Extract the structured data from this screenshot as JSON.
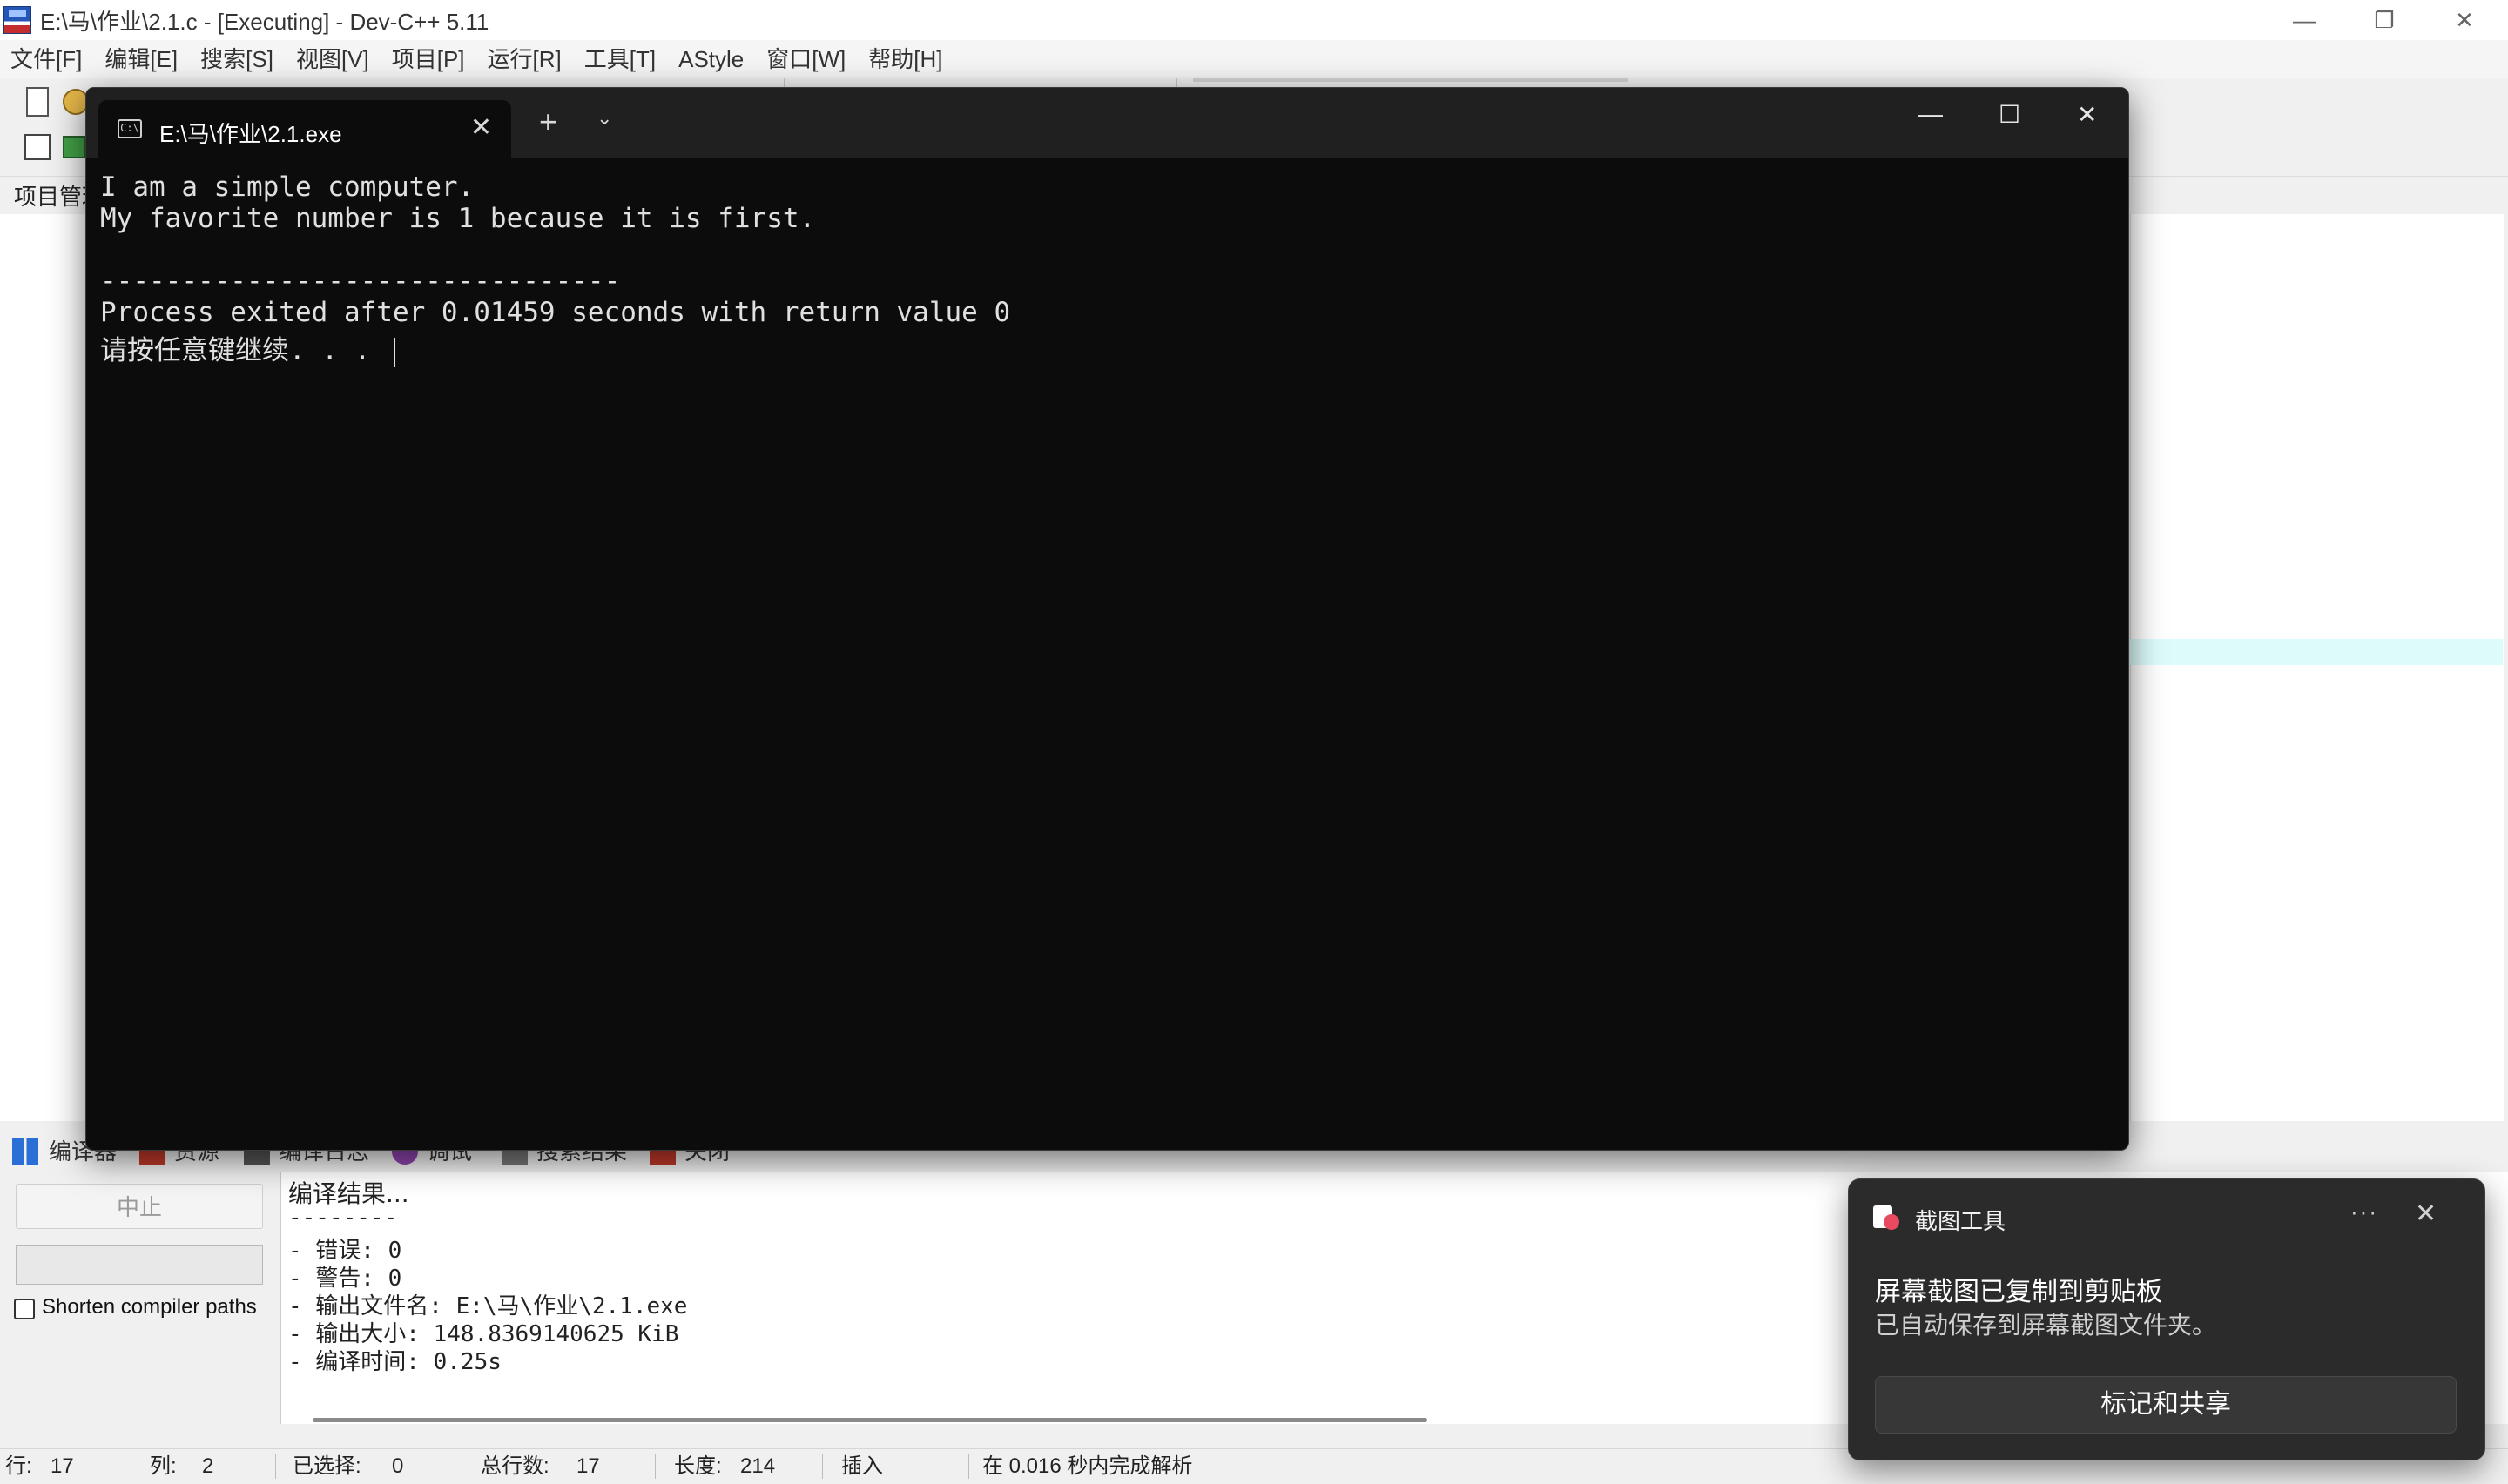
{
  "ide": {
    "title": "E:\\马\\作业\\2.1.c - [Executing] - Dev-C++ 5.11",
    "window_controls": {
      "minimize": "—",
      "restore": "❐",
      "close": "✕"
    },
    "menu": [
      "文件[F]",
      "编辑[E]",
      "搜索[S]",
      "视图[V]",
      "项目[P]",
      "运行[R]",
      "工具[T]",
      "AStyle",
      "窗口[W]",
      "帮助[H]"
    ],
    "project_label": "项目管理",
    "bottom_tabs": [
      "编译器",
      "资源",
      "编译日志",
      "调试",
      "搜索结果",
      "关闭"
    ],
    "compiler": {
      "abort_label": "中止",
      "shorten_label": "Shorten compiler paths",
      "log": [
        "编译结果...",
        "--------",
        "- 错误: 0",
        "- 警告: 0",
        "- 输出文件名: E:\\马\\作业\\2.1.exe",
        "- 输出大小: 148.8369140625 KiB",
        "- 编译时间: 0.25s"
      ]
    },
    "status": {
      "line_label": "行:",
      "line_value": "17",
      "col_label": "列:",
      "col_value": "2",
      "sel_label": "已选择:",
      "sel_value": "0",
      "total_label": "总行数:",
      "total_value": "17",
      "len_label": "长度:",
      "len_value": "214",
      "mode": "插入",
      "parse_msg": "在 0.016 秒内完成解析"
    }
  },
  "terminal": {
    "tab_title": "E:\\马\\作业\\2.1.exe",
    "tab_icon_text": "C:\\",
    "new_tab": "+",
    "dropdown": "⌄",
    "controls": {
      "minimize": "—",
      "maximize": "☐",
      "close": "✕"
    },
    "lines": [
      "I am a simple computer.",
      "My favorite number is 1 because it is first.",
      "",
      "--------------------------------",
      "Process exited after 0.01459 seconds with return value 0",
      "请按任意键继续. . . "
    ]
  },
  "toast": {
    "app_name": "截图工具",
    "more": "···",
    "close": "✕",
    "headline": "屏幕截图已复制到剪贴板",
    "body": "已自动保存到屏幕截图文件夹。",
    "action": "标记和共享"
  }
}
